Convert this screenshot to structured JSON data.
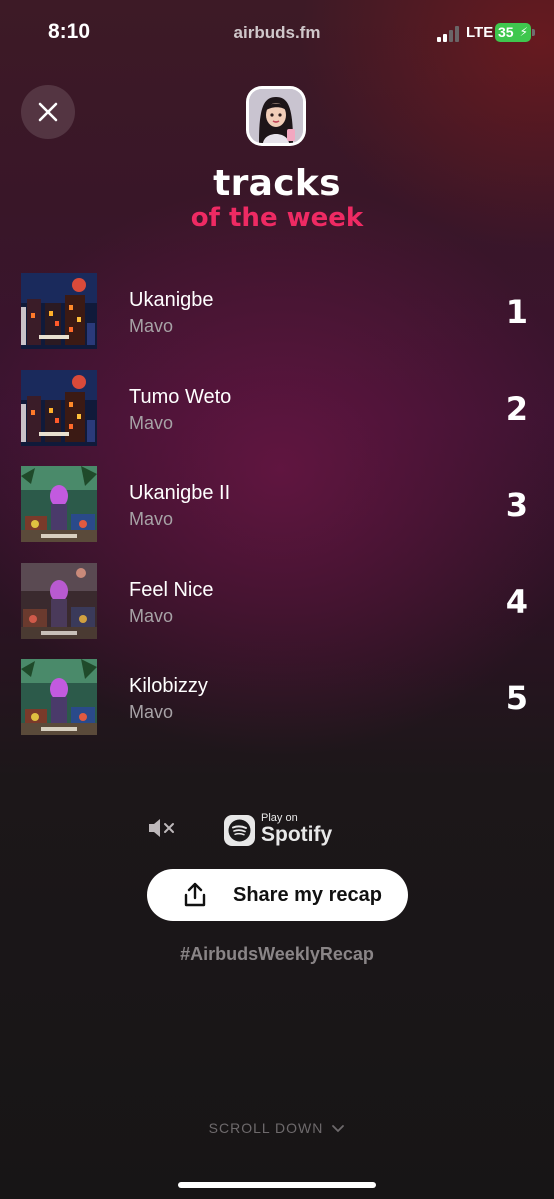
{
  "status_bar": {
    "time": "8:10",
    "url": "airbuds.fm",
    "network": "LTE",
    "battery": "35"
  },
  "header": {
    "title": "tracks",
    "subtitle": "of the week",
    "accent_color": "#ee2a63"
  },
  "tracks": [
    {
      "title": "Ukanigbe",
      "artist": "Mavo",
      "rank": "1"
    },
    {
      "title": "Tumo Weto",
      "artist": "Mavo",
      "rank": "2"
    },
    {
      "title": "Ukanigbe II",
      "artist": "Mavo",
      "rank": "3"
    },
    {
      "title": "Feel Nice",
      "artist": "Mavo",
      "rank": "4"
    },
    {
      "title": "Kilobizzy",
      "artist": "Mavo",
      "rank": "5"
    }
  ],
  "spotify": {
    "play_on": "Play on",
    "name": "Spotify"
  },
  "share": {
    "label": "Share my recap"
  },
  "hashtag": "#AirbudsWeeklyRecap",
  "scroll_hint": "SCROLL DOWN"
}
